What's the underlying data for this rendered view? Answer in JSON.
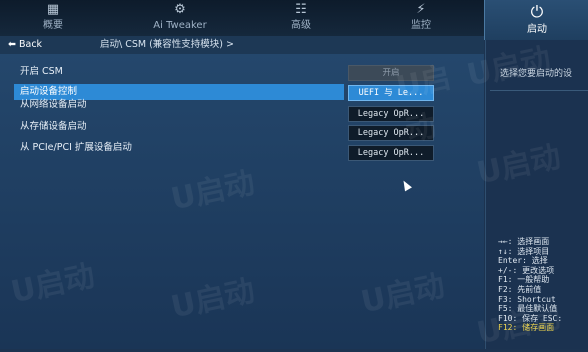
{
  "tabs": [
    {
      "label": "概要",
      "icon": "overview-icon"
    },
    {
      "label": "Ai Tweaker",
      "icon": "ai-tweaker-icon"
    },
    {
      "label": "高级",
      "icon": "advanced-icon"
    },
    {
      "label": "监控",
      "icon": "monitor-icon"
    },
    {
      "label": "启动",
      "icon": "power-icon"
    }
  ],
  "back_label": "Back",
  "breadcrumb": "启动\\ CSM (兼容性支持模块) >",
  "settings": [
    {
      "label": "开启 CSM",
      "value": "开启",
      "state": "disabled"
    },
    {
      "label": "启动设备控制",
      "value": "UEFI 与 Le...",
      "state": "selected"
    },
    {
      "label": "从网络设备启动",
      "value": "Legacy OpR...",
      "state": "normal"
    },
    {
      "label": "从存储设备启动",
      "value": "Legacy OpR...",
      "state": "normal"
    },
    {
      "label": "从 PCIe/PCI 扩展设备启动",
      "value": "Legacy OpR...",
      "state": "normal"
    }
  ],
  "help_text": "选择您要启动的设",
  "keys": [
    "→←: 选择画面",
    "↑↓: 选择项目",
    "Enter: 选择",
    "+/-: 更改选项",
    "F1: 一般帮助",
    "F2: 先前值",
    "F3: Shortcut",
    "F5: 最佳默认值",
    "F10: 保存  ESC:",
    "F12: 储存画面"
  ],
  "watermark": "U启动",
  "colors": {
    "accent": "#2d8ad6",
    "highlight_key": "#f0d64a"
  }
}
